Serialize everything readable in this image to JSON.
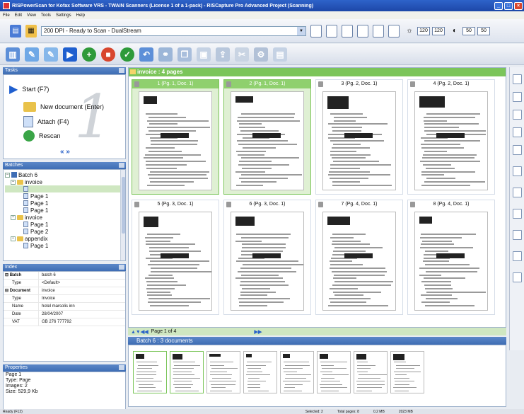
{
  "window": {
    "title": "RISPowerScan for Kofax Software VRS - TWAIN Scanners (License 1 of a 1-pack) - RISCapture Pro Advanced Project (Scanning)"
  },
  "menu": [
    "File",
    "Edit",
    "View",
    "Tools",
    "Settings",
    "Help"
  ],
  "toolbar1": {
    "profile": "200 DPI - Ready to Scan - DualStream",
    "dpi_x": "120",
    "dpi_y": "120",
    "contrast": "50",
    "brightness": "50"
  },
  "tasks": {
    "title": "Tasks",
    "items": [
      {
        "label": "Start (F7)",
        "icon": "play-icon"
      },
      {
        "label": "New document (Enter)",
        "icon": "folder-icon"
      },
      {
        "label": "Attach (F4)",
        "icon": "attach-icon"
      },
      {
        "label": "Rescan",
        "icon": "rescan-icon"
      }
    ],
    "watermark": "1"
  },
  "batches": {
    "title": "Batches",
    "tree": [
      {
        "label": "Batch 6",
        "level": 0,
        "kind": "batch"
      },
      {
        "label": "invoice",
        "level": 1,
        "kind": "folder"
      },
      {
        "label": "",
        "level": 2,
        "kind": "page",
        "selected": true
      },
      {
        "label": "Page 1",
        "level": 2,
        "kind": "page"
      },
      {
        "label": "Page 1",
        "level": 2,
        "kind": "page"
      },
      {
        "label": "Page 1",
        "level": 2,
        "kind": "page"
      },
      {
        "label": "invoice",
        "level": 1,
        "kind": "folder"
      },
      {
        "label": "Page 1",
        "level": 2,
        "kind": "page"
      },
      {
        "label": "Page 2",
        "level": 2,
        "kind": "page"
      },
      {
        "label": "appendix",
        "level": 1,
        "kind": "folder"
      },
      {
        "label": "Page 1",
        "level": 2,
        "kind": "page"
      }
    ]
  },
  "index": {
    "title": "Index",
    "rows": [
      {
        "key": "Batch",
        "value": "batch 6",
        "group": true
      },
      {
        "key": "Type",
        "value": "<Default>",
        "group": false
      },
      {
        "key": "Document",
        "value": "invoice",
        "group": true
      },
      {
        "key": "Type",
        "value": "Invoice",
        "group": false
      },
      {
        "key": "Name",
        "value": "hotel marsolis inn",
        "group": false
      },
      {
        "key": "Date",
        "value": "28/04/2007",
        "group": false
      },
      {
        "key": "VAT",
        "value": "GB 276 777792",
        "group": false
      }
    ]
  },
  "properties": {
    "title": "Properties",
    "lines": [
      "Page 1",
      "",
      "Type: Page",
      "Images: 2",
      "Size: 529,9 Kb"
    ]
  },
  "main": {
    "header": "invoice : 4 pages",
    "pages": [
      {
        "caption": "1 (Pg. 1, Doc. 1)",
        "selected": true
      },
      {
        "caption": "2 (Pg. 1, Doc. 1)",
        "selected": true
      },
      {
        "caption": "3 (Pg. 2, Doc. 1)",
        "selected": false
      },
      {
        "caption": "4 (Pg. 2, Doc. 1)",
        "selected": false
      },
      {
        "caption": "5 (Pg. 3, Doc. 1)",
        "selected": false
      },
      {
        "caption": "6 (Pg. 3, Doc. 1)",
        "selected": false
      },
      {
        "caption": "7 (Pg. 4, Doc. 1)",
        "selected": false
      },
      {
        "caption": "8 (Pg. 4, Doc. 1)",
        "selected": false
      }
    ],
    "page_nav": "Page 1 of 4"
  },
  "batch_strip": {
    "header": "Batch 6 : 3 documents"
  },
  "status": {
    "left": "Ready (F12)",
    "selected": "Selected: 2",
    "total": "Total pages: 8",
    "memory": "0.2 MB",
    "disk": "2023 MB"
  },
  "colors": {
    "accent_blue": "#3e6db4",
    "selection_green": "#7bc55a"
  }
}
